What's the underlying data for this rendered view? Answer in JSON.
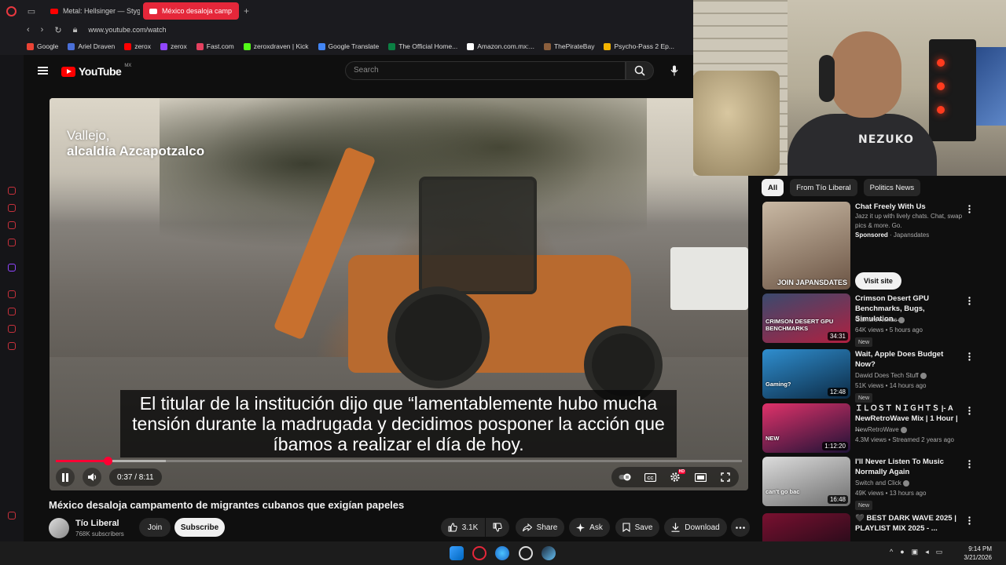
{
  "browser": {
    "tabs": [
      {
        "label": "Metal: Hellsinger — Stygia",
        "active": false
      },
      {
        "label": "México desaloja camp",
        "active": true
      }
    ],
    "url": "www.youtube.com/watch",
    "bookmarks": [
      {
        "label": "Google",
        "color": "#ea4335"
      },
      {
        "label": "Ariel Draven",
        "color": "#4a6fd8"
      },
      {
        "label": "zerox",
        "color": "#ff0000"
      },
      {
        "label": "zerox",
        "color": "#9146ff"
      },
      {
        "label": "Fast.com",
        "color": "#e4405f"
      },
      {
        "label": "zeroxdraven | Kick",
        "color": "#53fc18"
      },
      {
        "label": "Google Translate",
        "color": "#4285f4"
      },
      {
        "label": "The Official Home...",
        "color": "#0b8043"
      },
      {
        "label": "Amazon.com.mx:...",
        "color": "#ffffff"
      },
      {
        "label": "ThePirateBay",
        "color": "#8b5e3c"
      },
      {
        "label": "Psycho-Pass 2 Ep...",
        "color": "#f4b400"
      }
    ]
  },
  "youtube": {
    "logo_text": "YouTube",
    "region": "MX",
    "search_placeholder": "Search"
  },
  "video": {
    "location_line1": "Vallejo,",
    "location_line2": "alcaldía Azcapotzalco",
    "subtitle": "El titular de la institución dijo que “lamentablemente hubo mucha tensión durante la madrugada y decidimos posponer la acción que íbamos a realizar el día de hoy.",
    "time_display": "0:37 / 8:11",
    "progress_fraction": 0.076,
    "buffer_fraction": 0.16,
    "title": "México desaloja campamento de migrantes cubanos que exigían papeles",
    "channel_name": "Tío Liberal",
    "subscribers": "768K subscribers",
    "join_label": "Join",
    "subscribe_label": "Subscribe",
    "likes": "3.1K",
    "share_label": "Share",
    "ask_label": "Ask",
    "save_label": "Save",
    "download_label": "Download"
  },
  "webcam": {
    "shirt_text": "NEZUKO"
  },
  "sidebar_chips": [
    "All",
    "From Tío Liberal",
    "Politics News"
  ],
  "recommendations": [
    {
      "title": "Chat Freely With Us",
      "desc": "Jazz it up with lively chats. Chat, swap pics & more. Go.",
      "sponsored": "Sponsored",
      "advertiser": "Japansdates",
      "thumb_text": "JOIN JAPANSDATES",
      "cta": "Visit site"
    },
    {
      "title": "Crimson Desert GPU Benchmarks, Bugs, Simulation...",
      "channel": "Gamers Nexus",
      "meta": "64K views • 5 hours ago",
      "badge": "New",
      "duration": "34:31",
      "thumb_text": "CRIMSON DESERT GPU BENCHMARKS"
    },
    {
      "title": "Wait, Apple Does Budget Now?",
      "channel": "Dawid Does Tech Stuff",
      "meta": "51K views • 14 hours ago",
      "badge": "New",
      "duration": "12:48",
      "thumb_text": "Gaming?"
    },
    {
      "title": "ＩＬＯＳＴ ＮＩＧＨＴＳ |- A NewRetroWave Mix | 1 Hour | ...",
      "channel": "NewRetroWave",
      "meta": "4.3M views • Streamed 2 years ago",
      "duration": "1:12:20",
      "thumb_text": "NEW"
    },
    {
      "title": "I'll Never Listen To Music Normally Again",
      "channel": "Switch and Click",
      "meta": "49K views • 13 hours ago",
      "badge": "New",
      "duration": "16:48",
      "thumb_text": "can't go bac"
    },
    {
      "title": "🖤 BEST DARK WAVE 2025 | PLAYLIST MIX 2025 - ...",
      "channel": "",
      "meta": ""
    }
  ],
  "taskbar": {
    "time": "9:14 PM",
    "date": "3/21/2026"
  }
}
